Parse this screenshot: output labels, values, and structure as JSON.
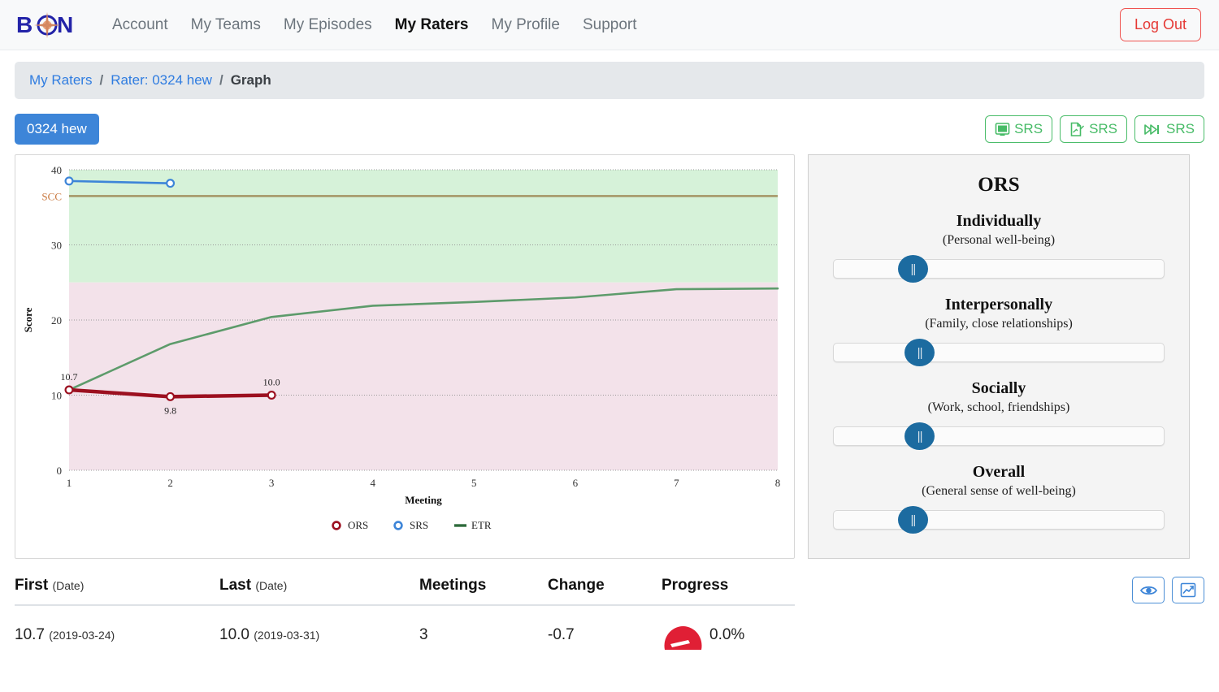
{
  "navbar": {
    "brand": "BON",
    "brand_icon": "compass-rose-icon",
    "links": [
      {
        "label": "Account",
        "active": false
      },
      {
        "label": "My Teams",
        "active": false
      },
      {
        "label": "My Episodes",
        "active": false
      },
      {
        "label": "My Raters",
        "active": true
      },
      {
        "label": "My Profile",
        "active": false
      },
      {
        "label": "Support",
        "active": false
      }
    ],
    "logout_label": "Log Out",
    "accent_logout": "#e53935"
  },
  "breadcrumb": {
    "items": [
      {
        "label": "My Raters",
        "link": true
      },
      {
        "label": "Rater: 0324 hew",
        "link": true
      },
      {
        "label": "Graph",
        "link": false
      }
    ],
    "separator": "/",
    "link_color": "#2f7ce0"
  },
  "subbar": {
    "rater_badge": "0324 hew",
    "badge_color": "#3d85d8",
    "srs_buttons": [
      {
        "label": "SRS",
        "icon": "monitor-icon"
      },
      {
        "label": "SRS",
        "icon": "document-edit-icon"
      },
      {
        "label": "SRS",
        "icon": "skip-forward-icon"
      }
    ],
    "srs_color": "#46bb66"
  },
  "ors_panel": {
    "title": "ORS",
    "items": [
      {
        "label": "Individually",
        "sub": "(Personal well-being)",
        "value_pct": 24
      },
      {
        "label": "Interpersonally",
        "sub": "(Family, close relationships)",
        "value_pct": 26
      },
      {
        "label": "Socially",
        "sub": "(Work, school, friendships)",
        "value_pct": 26
      },
      {
        "label": "Overall",
        "sub": "(General sense of well-being)",
        "value_pct": 24
      }
    ],
    "thumb_color": "#1c6ba0"
  },
  "chart_data": {
    "type": "line",
    "title": "",
    "xlabel": "Meeting",
    "ylabel": "Score",
    "x": [
      1,
      2,
      3,
      4,
      5,
      6,
      7,
      8
    ],
    "xticklabels": [
      "1",
      "2",
      "3",
      "4",
      "5",
      "6",
      "7",
      "8"
    ],
    "yticks": [
      0,
      10,
      20,
      30,
      40
    ],
    "yticklabels": [
      "0",
      "10",
      "20",
      "30",
      "40"
    ],
    "ylim": [
      0,
      40
    ],
    "xlim": [
      1,
      8
    ],
    "grid": true,
    "legend_position": "bottom",
    "series": [
      {
        "name": "ORS",
        "color": "#9c1020",
        "marker": "circle-open",
        "x": [
          1,
          2,
          3
        ],
        "values": [
          10.7,
          9.8,
          10.0
        ],
        "point_labels": [
          "10.7",
          "9.8",
          "10.0"
        ]
      },
      {
        "name": "SRS",
        "color": "#3d85d8",
        "marker": "circle-open",
        "x": [
          1,
          2
        ],
        "values": [
          38.5,
          38.2
        ],
        "point_labels": []
      },
      {
        "name": "ETR",
        "color": "#5d9b6b",
        "marker": "none",
        "x": [
          1,
          2,
          3,
          4,
          5,
          6,
          7,
          8
        ],
        "values": [
          10.7,
          16.8,
          20.4,
          21.9,
          22.4,
          23.0,
          24.1,
          24.2
        ],
        "point_labels": []
      }
    ],
    "reference_line": {
      "label": "SCC",
      "value": 36.5,
      "color": "#a59565",
      "label_color": "#c8763c"
    },
    "bands": [
      {
        "from": 25,
        "to": 40,
        "color": "#d6f2d9",
        "name": "clinical-range-upper"
      },
      {
        "from": 0,
        "to": 25,
        "color": "#f3e2ea",
        "name": "clinical-range-lower"
      }
    ],
    "legend": [
      {
        "label": "ORS",
        "color": "#9c1020"
      },
      {
        "label": "SRS",
        "color": "#3d85d8"
      },
      {
        "label": "ETR",
        "color": "#2f6b3c"
      }
    ]
  },
  "summary_table": {
    "headers": [
      {
        "main": "First",
        "sub": "(Date)"
      },
      {
        "main": "Last",
        "sub": "(Date)"
      },
      {
        "main": "Meetings",
        "sub": ""
      },
      {
        "main": "Change",
        "sub": ""
      },
      {
        "main": "Progress",
        "sub": ""
      }
    ],
    "row": {
      "first_value": "10.7",
      "first_date": "(2019-03-24)",
      "last_value": "10.0",
      "last_date": "(2019-03-31)",
      "meetings": "3",
      "change": "-0.7",
      "progress": "0.0%",
      "gauge_color": "#e01f35"
    }
  },
  "bottom_actions": [
    {
      "icon": "eye-icon",
      "name": "view-button"
    },
    {
      "icon": "chart-line-icon",
      "name": "graph-button"
    }
  ]
}
